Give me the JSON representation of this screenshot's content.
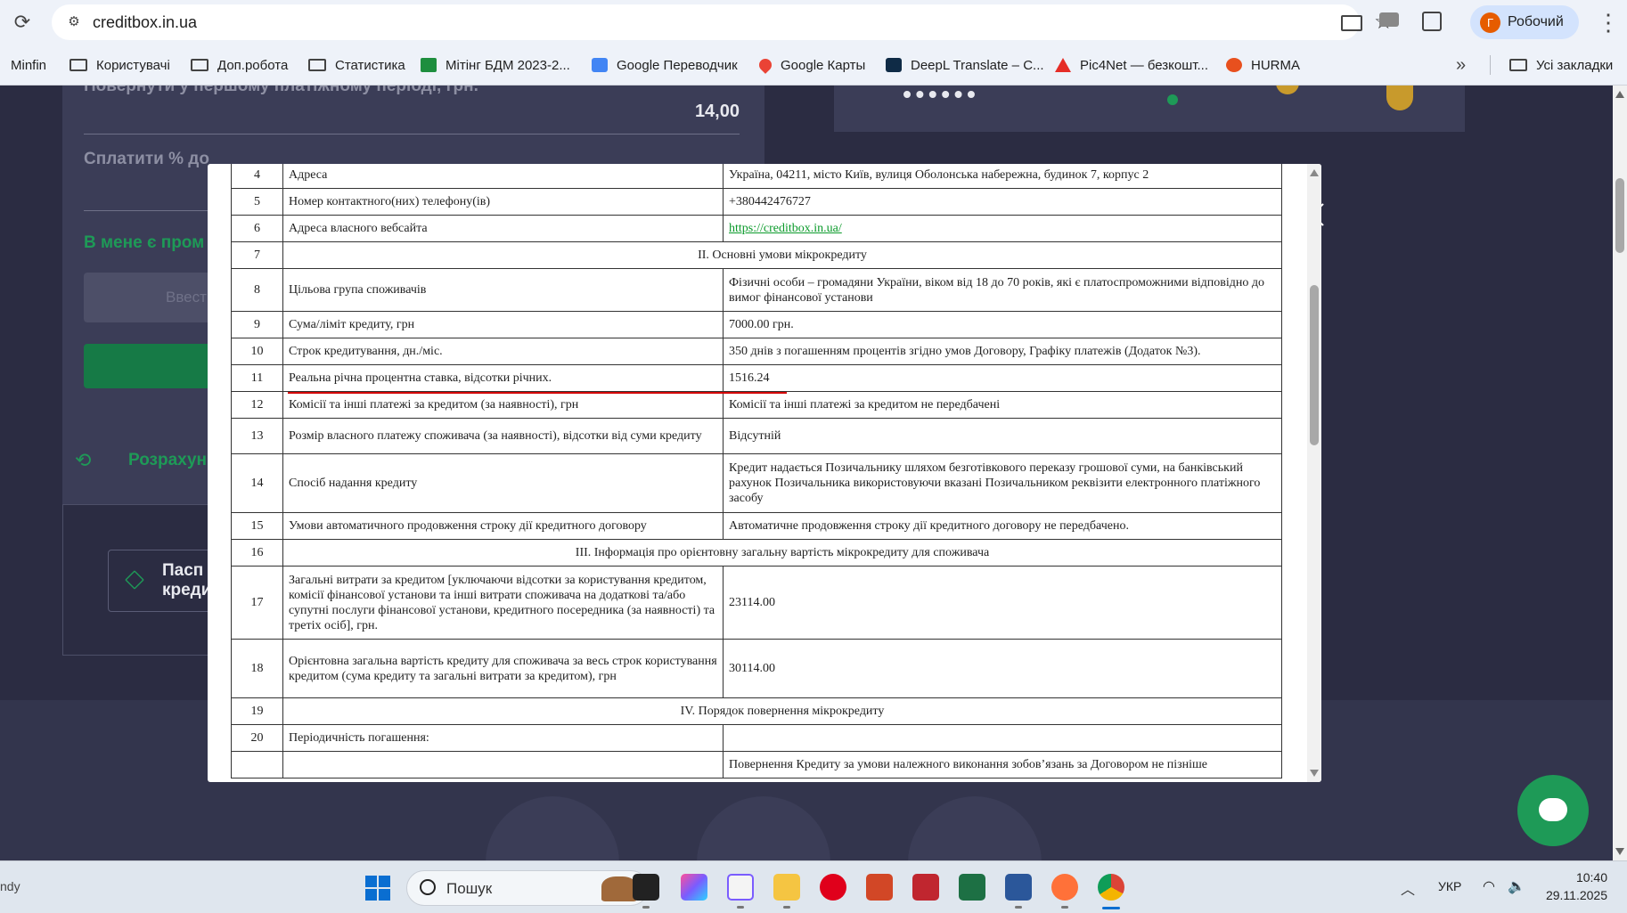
{
  "browser": {
    "url": "creditbox.in.ua",
    "profile_initial": "Г",
    "profile_name": "Робочий",
    "bookmarks": [
      {
        "label": "Minfin",
        "icon": "minfin-icon"
      },
      {
        "label": "Користувачі",
        "icon": "folder-icon"
      },
      {
        "label": "Доп.робота",
        "icon": "folder-icon"
      },
      {
        "label": "Статистика",
        "icon": "folder-icon"
      },
      {
        "label": "Мітінг БДМ 2023-2...",
        "icon": "google-sheets-icon"
      },
      {
        "label": "Google Переводчик",
        "icon": "google-translate-icon"
      },
      {
        "label": "Google Карты",
        "icon": "google-maps-icon"
      },
      {
        "label": "DeepL Translate – С...",
        "icon": "deepl-icon"
      },
      {
        "label": "Pic4Net — безкошт...",
        "icon": "pic4net-icon"
      },
      {
        "label": "HURMA",
        "icon": "hurma-icon"
      }
    ],
    "all_bookmarks": "Усі закладки"
  },
  "background_page": {
    "first_payment_label": "Повернути у першому платіжному періоді, грн.",
    "first_payment_value": "14,00",
    "pay_percent_label": "Сплатити % до",
    "promo_link": "В мене є пром",
    "promo_placeholder": "Ввести",
    "recalc_text": "Розрахун",
    "passport_text_line1": "Пасп",
    "passport_text_line2": "креди"
  },
  "table": {
    "rows": [
      {
        "num": "4",
        "label": "Адреса",
        "value": "Україна, 04211, місто Київ, вулиця Оболонська набережна, будинок 7, корпус 2"
      },
      {
        "num": "5",
        "label": "Номер контактного(них) телефону(ів)",
        "value": "+380442476727"
      },
      {
        "num": "6",
        "label": "Адреса власного вебсайта",
        "value": "https://creditbox.in.ua/",
        "link": true
      },
      {
        "num": "7",
        "section": "ІІ. Основні умови мікрокредиту"
      },
      {
        "num": "8",
        "label": "Цільова група споживачів",
        "value": "Фізичні особи – громадяни України, віком від 18 до 70 років, які є платоспроможними відповідно до вимог фінансової установи"
      },
      {
        "num": "9",
        "label": "Сума/ліміт кредиту, грн",
        "value": "7000.00 грн."
      },
      {
        "num": "10",
        "label": "Строк кредитування, дн./міс.",
        "value": "350 днів з погашенням процентів згідно умов Договору, Графіку платежів (Додаток №3)."
      },
      {
        "num": "11",
        "label": "Реальна річна процентна ставка, відсотки річних.",
        "value": "1516.24"
      },
      {
        "num": "12",
        "label": "Комісії та інші платежі за кредитом (за наявності), грн",
        "value": "Комісії та інші платежі за кредитом не передбачені"
      },
      {
        "num": "13",
        "label": "Розмір власного платежу споживача (за наявності), відсотки від суми кредиту",
        "value": "Відсутній"
      },
      {
        "num": "14",
        "label": "Спосіб надання кредиту",
        "value": "Кредит надається Позичальнику шляхом безготівкового переказу грошової суми, на банківський рахунок Позичальника використовуючи вказані Позичальником реквізити електронного платіжного засобу"
      },
      {
        "num": "15",
        "label": "Умови автоматичного продовження строку дії кредитного договору",
        "value": "Автоматичне продовження строку дії кредитного договору не передбачено."
      },
      {
        "num": "16",
        "section": "ІІІ. Інформація про орієнтовну загальну вартість мікрокредиту для споживача"
      },
      {
        "num": "17",
        "label": "Загальні витрати за кредитом [уключаючи відсотки за користування кредитом, комісії фінансової установи та інші витрати споживача на додаткові та/або супутні послуги фінансової установи, кредитного посередника (за наявності) та третіх осіб], грн.",
        "value": "23114.00"
      },
      {
        "num": "18",
        "label": "Орієнтовна загальна вартість кредиту для споживача за весь строк користування кредитом (сума кредиту та загальні витрати за кредитом), грн",
        "value": "30114.00"
      },
      {
        "num": "19",
        "section": "ІV. Порядок повернення мікрокредиту"
      },
      {
        "num": "20",
        "label": "Періодичність погашення:",
        "value": ""
      },
      {
        "num": "",
        "label": "",
        "value": "Повернення Кредиту за умови належного виконання зобов’язань за Договором не пізніше"
      }
    ]
  },
  "taskbar": {
    "left_text": "ndy",
    "search_placeholder": "Пошук",
    "lang": "УКР",
    "time": "10:40",
    "date": "29.11.2025"
  },
  "colors": {
    "page_bg": "#2b2c42",
    "accent_green": "#1e9a57",
    "underline_red": "#d40000"
  }
}
